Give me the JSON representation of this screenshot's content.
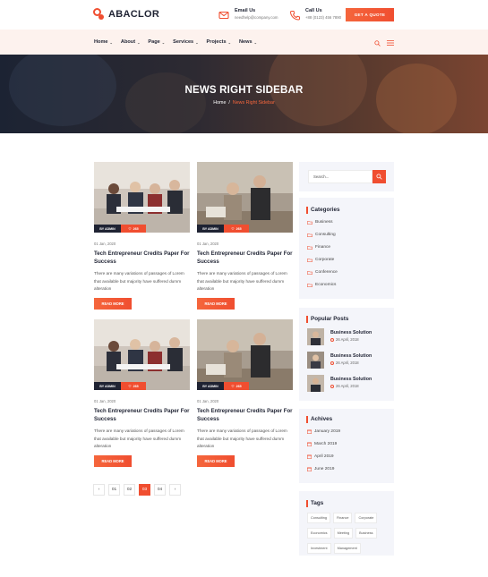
{
  "brand": {
    "name": "ABACLOR",
    "accent": "#f04e30"
  },
  "header": {
    "email": {
      "label": "Email Us",
      "value": "needhelp@company.com"
    },
    "call": {
      "label": "Call Us",
      "value": "+88 (0123) 456 7890"
    },
    "quote_button": "GET A QUOTE"
  },
  "nav": {
    "items": [
      "Home",
      "About",
      "Page",
      "Services",
      "Projects",
      "News"
    ]
  },
  "banner": {
    "title": "NEWS RIGHT SIDEBAR",
    "breadcrumb_home": "Home",
    "breadcrumb_sep": "/",
    "breadcrumb_current": "News Right Sidebar"
  },
  "posts": [
    {
      "author": "BY ADMIN",
      "likes": "265",
      "date": "01 Jan, 2020",
      "title": "Tech Entrepreneur Credits Paper For Success",
      "excerpt": "There are many variations of passages of Lorem that available but majority have suffered dumm alteration",
      "button": "READ MORE"
    },
    {
      "author": "BY ADMIN",
      "likes": "265",
      "date": "01 Jan, 2020",
      "title": "Tech Entrepreneur Credits Paper For Success",
      "excerpt": "There are many variations of passages of Lorem that available but majority have suffered dumm alteration",
      "button": "READ MORE"
    },
    {
      "author": "BY ADMIN",
      "likes": "265",
      "date": "01 Jan, 2020",
      "title": "Tech Entrepreneur Credits Paper For Success",
      "excerpt": "There are many variations of passages of Lorem that available but majority have suffered dumm alteration",
      "button": "READ MORE"
    },
    {
      "author": "BY ADMIN",
      "likes": "265",
      "date": "01 Jan, 2020",
      "title": "Tech Entrepreneur Credits Paper For Success",
      "excerpt": "There are many variations of passages of Lorem that available but majority have suffered dumm alteration",
      "button": "READ MORE"
    }
  ],
  "pagination": {
    "prev": "‹",
    "pages": [
      "01",
      "02",
      "03",
      "04"
    ],
    "active": "03",
    "next": "›"
  },
  "sidebar": {
    "search": {
      "placeholder": "Search..."
    },
    "categories": {
      "title": "Categories",
      "items": [
        "Business",
        "Consulting",
        "Finance",
        "Corporate",
        "Conference",
        "Economics"
      ]
    },
    "popular_posts": {
      "title": "Popular Posts",
      "items": [
        {
          "title": "Business Solution",
          "date": "26 April, 2018"
        },
        {
          "title": "Business Solution",
          "date": "26 April, 2018"
        },
        {
          "title": "Business Solution",
          "date": "26 April, 2018"
        }
      ]
    },
    "archives": {
      "title": "Achives",
      "items": [
        "January 2019",
        "March 2019",
        "April 2019",
        "June 2019"
      ]
    },
    "tags": {
      "title": "Tags",
      "items": [
        "Consulting",
        "Finance",
        "Corporate",
        "Economics",
        "Meeting",
        "Business",
        "Investment",
        "Management"
      ]
    }
  },
  "icons": {
    "email": "envelope-icon",
    "phone": "phone-icon",
    "search": "search-icon",
    "menu": "hamburger-icon",
    "heart": "heart-icon",
    "folder": "folder-icon",
    "clock": "clock-icon",
    "calendar": "calendar-icon"
  }
}
